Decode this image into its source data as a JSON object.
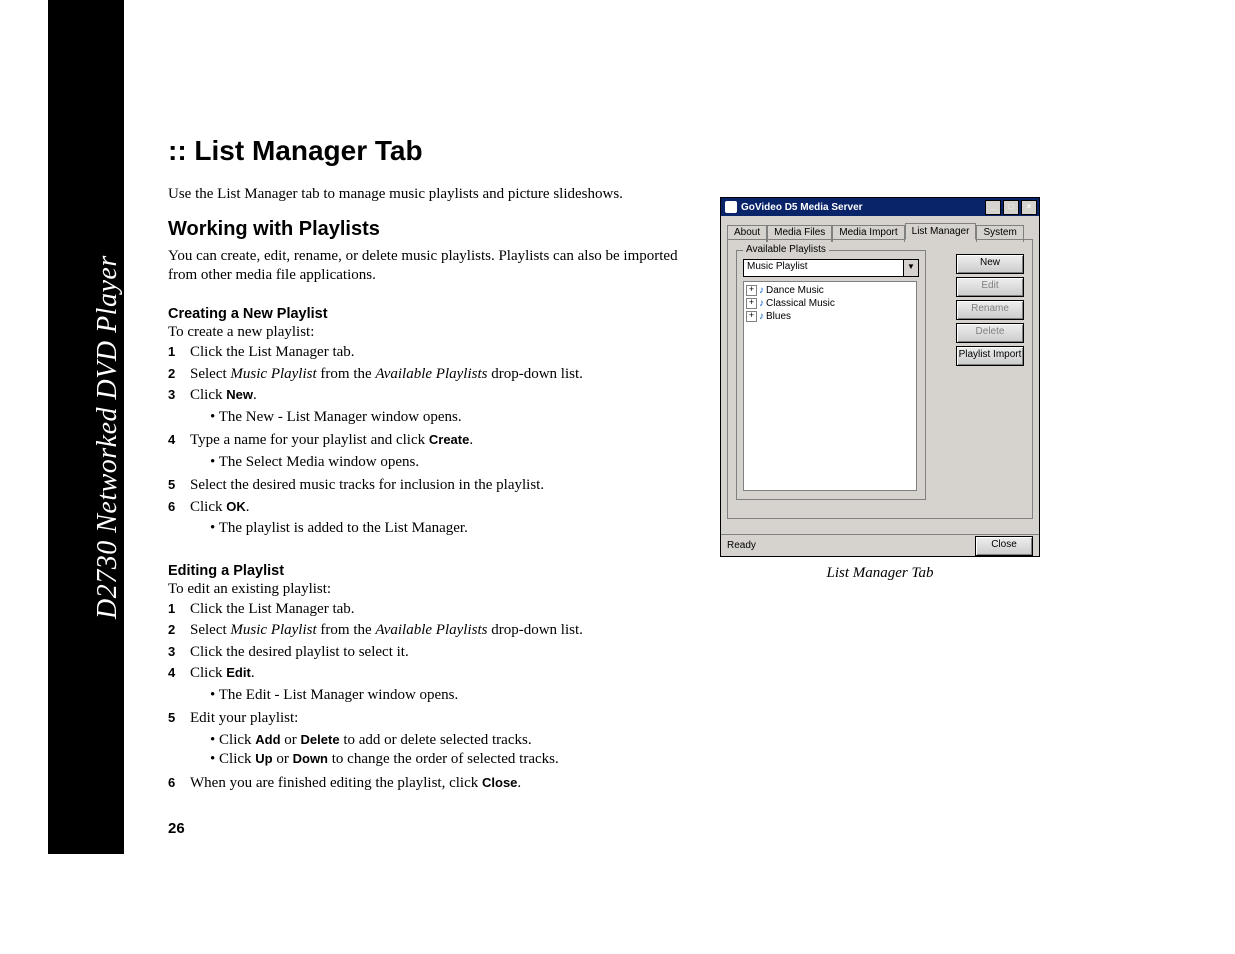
{
  "sidebar_label": "D2730 Networked DVD Player",
  "page_number": "26",
  "page_title": ":: List Manager Tab",
  "intro": "Use the List Manager tab to manage music playlists and picture slideshows.",
  "h2_playlists": "Working with Playlists",
  "playlists_para": "You can create, edit, rename, or delete music playlists. Playlists can also be imported from other media file applications.",
  "h3_create": "Creating a New Playlist",
  "create_lead": "To create a new playlist:",
  "create": {
    "s1": "Click the List Manager tab.",
    "s2a": "Select ",
    "s2b": "Music Playlist",
    "s2c": " from the ",
    "s2d": "Available Playlists",
    "s2e": " drop-down list.",
    "s3a": "Click ",
    "s3b": "New",
    "s3c": ".",
    "s3sub": "The New - List Manager window opens.",
    "s4a": "Type a name for your playlist and click ",
    "s4b": "Create",
    "s4c": ".",
    "s4sub": "The Select Media window opens.",
    "s5": "Select the desired music tracks for inclusion in the playlist.",
    "s6a": "Click ",
    "s6b": "OK",
    "s6c": ".",
    "s6sub": "The playlist is added to the List Manager."
  },
  "h3_edit": "Editing a Playlist",
  "edit_lead": "To edit an existing playlist:",
  "edit": {
    "s1": "Click the List Manager tab.",
    "s2a": "Select ",
    "s2b": "Music Playlist",
    "s2c": " from the ",
    "s2d": "Available Playlists",
    "s2e": " drop-down list.",
    "s3": "Click the desired playlist to select it.",
    "s4a": "Click ",
    "s4b": "Edit",
    "s4c": ".",
    "s4sub": "The Edit - List Manager window opens.",
    "s5": "Edit your playlist:",
    "s5sub1a": "Click ",
    "s5sub1b": "Add",
    "s5sub1c": " or ",
    "s5sub1d": "Delete",
    "s5sub1e": " to add or delete selected tracks.",
    "s5sub2a": "Click ",
    "s5sub2b": "Up",
    "s5sub2c": " or ",
    "s5sub2d": "Down",
    "s5sub2e": " to change the order of selected tracks.",
    "s6a": "When you are finished editing the playlist, click ",
    "s6b": "Close",
    "s6c": "."
  },
  "shot_caption": "List Manager Tab",
  "win": {
    "title": "GoVideo D5 Media Server",
    "min": "_",
    "max": "□",
    "close": "×",
    "tabs": {
      "about": "About",
      "mediafiles": "Media Files",
      "mediaimport": "Media Import",
      "listmanager": "List Manager",
      "system": "System"
    },
    "fieldset_legend": "Available Playlists",
    "dropdown_value": "Music Playlist",
    "dropdown_arrow": "▼",
    "tree": {
      "expand": "+",
      "item1": "Dance Music",
      "item2": "Classical Music",
      "item3": "Blues",
      "micon": "♪"
    },
    "buttons": {
      "new": "New",
      "edit": "Edit",
      "rename": "Rename",
      "delete": "Delete",
      "import": "Playlist Import"
    },
    "status": "Ready",
    "close_btn": "Close"
  }
}
